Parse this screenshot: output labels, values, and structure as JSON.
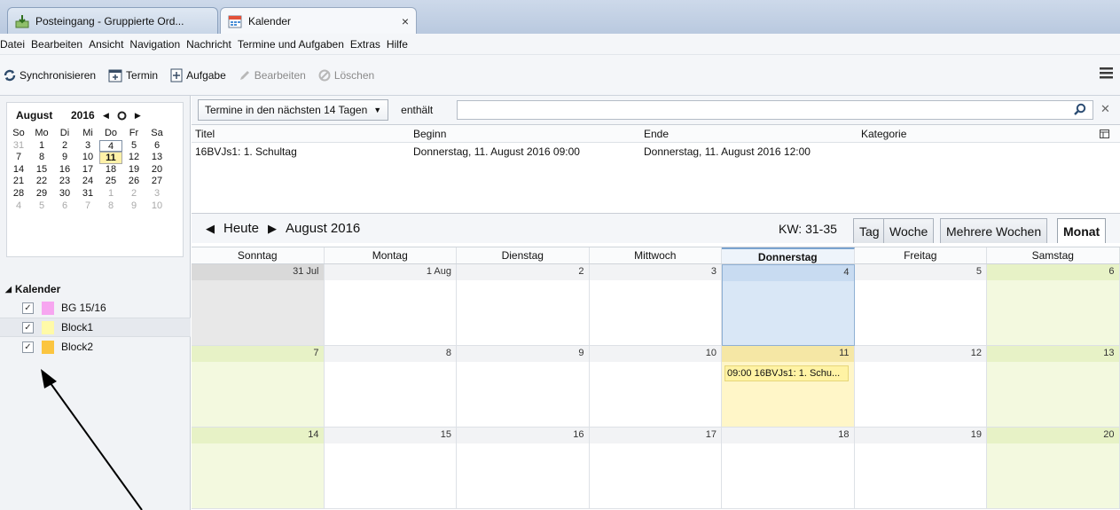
{
  "tabs": [
    {
      "label": "Posteingang - Gruppierte Ord..."
    },
    {
      "label": "Kalender",
      "close": "×"
    }
  ],
  "menu": [
    "Datei",
    "Bearbeiten",
    "Ansicht",
    "Navigation",
    "Nachricht",
    "Termine und Aufgaben",
    "Extras",
    "Hilfe"
  ],
  "toolbar": {
    "sync": "Synchronisieren",
    "event": "Termin",
    "task": "Aufgabe",
    "edit": "Bearbeiten",
    "delete": "Löschen"
  },
  "minical": {
    "month": "August",
    "year": "2016",
    "weekdays": [
      "So",
      "Mo",
      "Di",
      "Mi",
      "Do",
      "Fr",
      "Sa"
    ],
    "weeks": [
      [
        {
          "d": "31",
          "out": true
        },
        {
          "d": "1"
        },
        {
          "d": "2"
        },
        {
          "d": "3"
        },
        {
          "d": "4",
          "sel": true
        },
        {
          "d": "5"
        },
        {
          "d": "6"
        }
      ],
      [
        {
          "d": "7"
        },
        {
          "d": "8"
        },
        {
          "d": "9"
        },
        {
          "d": "10"
        },
        {
          "d": "11",
          "today": true
        },
        {
          "d": "12"
        },
        {
          "d": "13"
        }
      ],
      [
        {
          "d": "14"
        },
        {
          "d": "15"
        },
        {
          "d": "16"
        },
        {
          "d": "17"
        },
        {
          "d": "18"
        },
        {
          "d": "19"
        },
        {
          "d": "20"
        }
      ],
      [
        {
          "d": "21"
        },
        {
          "d": "22"
        },
        {
          "d": "23"
        },
        {
          "d": "24"
        },
        {
          "d": "25"
        },
        {
          "d": "26"
        },
        {
          "d": "27"
        }
      ],
      [
        {
          "d": "28"
        },
        {
          "d": "29"
        },
        {
          "d": "30"
        },
        {
          "d": "31"
        },
        {
          "d": "1",
          "out": true
        },
        {
          "d": "2",
          "out": true
        },
        {
          "d": "3",
          "out": true
        }
      ],
      [
        {
          "d": "4",
          "out": true
        },
        {
          "d": "5",
          "out": true
        },
        {
          "d": "6",
          "out": true
        },
        {
          "d": "7",
          "out": true
        },
        {
          "d": "8",
          "out": true
        },
        {
          "d": "9",
          "out": true
        },
        {
          "d": "10",
          "out": true
        }
      ]
    ]
  },
  "calendars": {
    "heading": "Kalender",
    "items": [
      {
        "name": "BG 15/16",
        "color": "#f7a6f0",
        "checked": "✓"
      },
      {
        "name": "Block1",
        "color": "#fffaa8",
        "checked": "✓"
      },
      {
        "name": "Block2",
        "color": "#fbc540",
        "checked": "✓"
      }
    ]
  },
  "filter": {
    "select": "Termine in den nächsten 14 Tagen",
    "label": "enthält",
    "search_value": ""
  },
  "tasktable": {
    "headers": [
      "Titel",
      "Beginn",
      "Ende",
      "Kategorie"
    ],
    "rows": [
      [
        "16BVJs1: 1. Schultag",
        "Donnerstag, 11. August 2016 09:00",
        "Donnerstag, 11. August 2016 12:00",
        ""
      ]
    ]
  },
  "nav": {
    "today": "Heute",
    "month": "August 2016",
    "kw": "KW: 31-35",
    "views": [
      "Tag",
      "Woche",
      "Mehrere Wochen",
      "Monat"
    ]
  },
  "month": {
    "dayheads": [
      "Sonntag",
      "Montag",
      "Dienstag",
      "Mittwoch",
      "Donnerstag",
      "Freitag",
      "Samstag"
    ],
    "weeks": [
      [
        "31 Jul",
        "1 Aug",
        "2",
        "3",
        "4",
        "5",
        "6"
      ],
      [
        "7",
        "8",
        "9",
        "10",
        "11",
        "12",
        "13"
      ],
      [
        "14",
        "15",
        "16",
        "17",
        "18",
        "19",
        "20"
      ]
    ],
    "event": "09:00 16BVJs1: 1. Schu..."
  }
}
